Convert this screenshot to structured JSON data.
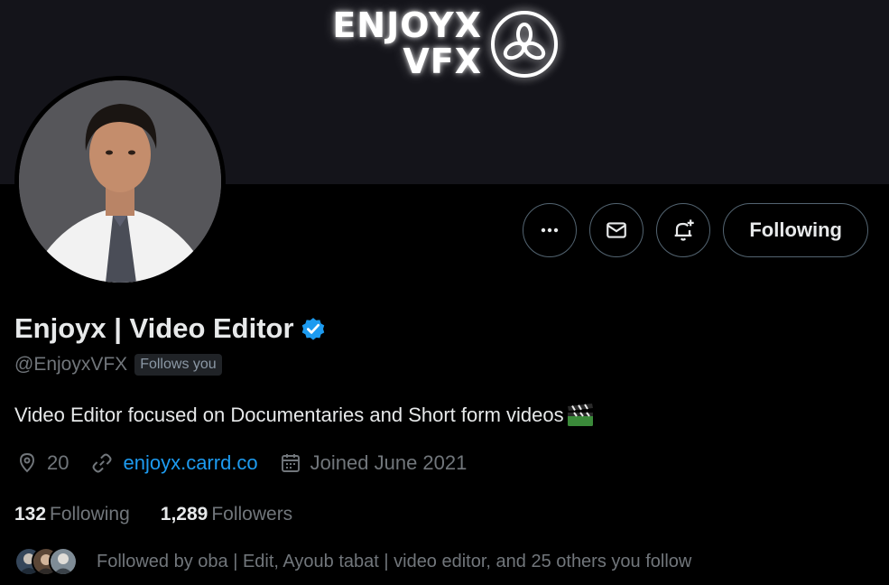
{
  "banner": {
    "logo_line1": "ENJOYX",
    "logo_line2": "VFX"
  },
  "profile": {
    "display_name": "Enjoyx | Video Editor",
    "handle": "@EnjoyxVFX",
    "follows_you_badge": "Follows you",
    "bio": "Video Editor focused on Documentaries and Short form videos",
    "location": "20",
    "website": "enjoyx.carrd.co",
    "joined": "Joined June 2021",
    "following_count": "132",
    "following_label": "Following",
    "followers_count": "1,289",
    "followers_label": "Followers",
    "followed_by": "Followed by oba | Edit, Ayoub tabat | video editor, and 25 others you follow"
  },
  "actions": {
    "more_icon": "more-horizontal-icon",
    "message_icon": "mail-icon",
    "notify_icon": "bell-plus-icon",
    "following_button": "Following"
  },
  "colors": {
    "accent": "#1d9bf0",
    "verified": "#1d9bf0",
    "muted": "#71767b",
    "text": "#e7e9ea"
  }
}
